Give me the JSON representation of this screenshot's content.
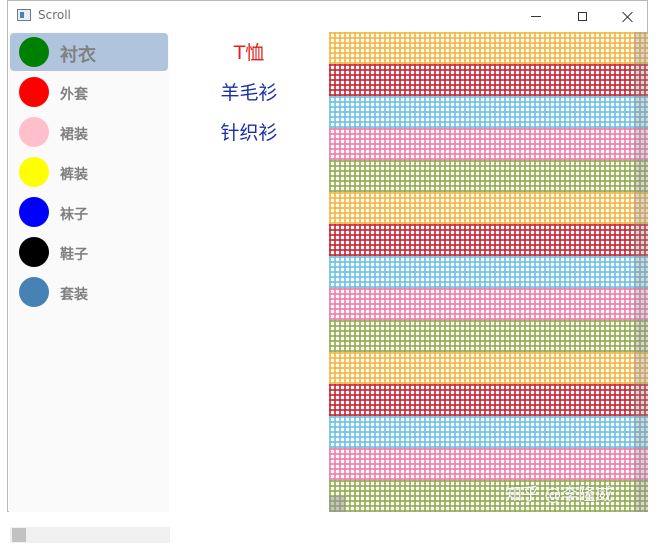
{
  "window": {
    "title": "Scroll"
  },
  "categories": [
    {
      "label": "衬衣",
      "color": "#008000",
      "selected": true
    },
    {
      "label": "外套",
      "color": "#ff0000"
    },
    {
      "label": "裙装",
      "color": "#ffc0cb"
    },
    {
      "label": "裤装",
      "color": "#ffff00"
    },
    {
      "label": "袜子",
      "color": "#0000ff"
    },
    {
      "label": "鞋子",
      "color": "#000000"
    },
    {
      "label": "套装",
      "color": "#4682b4"
    }
  ],
  "subcategories": [
    {
      "label": "T恤",
      "color": "#e0201a"
    },
    {
      "label": "羊毛衫",
      "color": "#1a2fa8"
    },
    {
      "label": "针织衫",
      "color": "#1a2fa8"
    }
  ],
  "swatches": [
    {
      "color": "#f5b33b"
    },
    {
      "color": "#c8202f"
    },
    {
      "color": "#6bc0e6"
    },
    {
      "color": "#ef7aa8"
    },
    {
      "color": "#8faa4a"
    }
  ],
  "watermark": "知乎 @李隆威"
}
